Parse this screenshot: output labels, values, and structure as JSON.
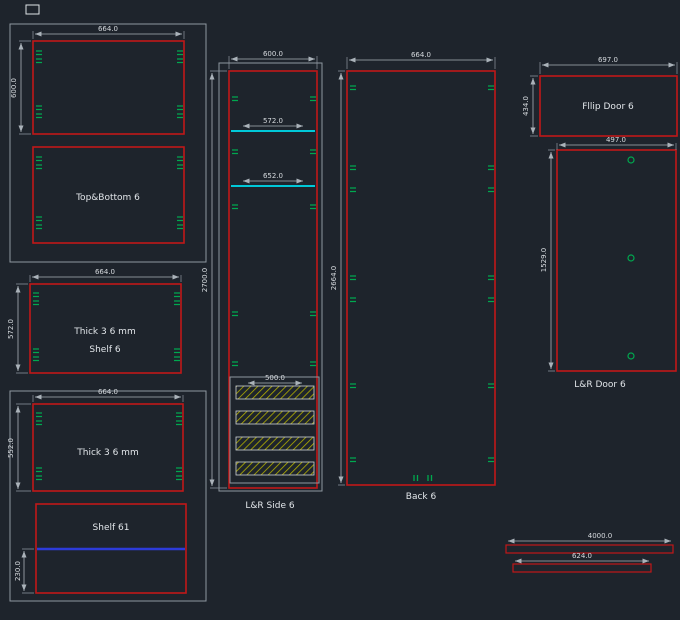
{
  "colors": {
    "background": "#1e242c",
    "panel_outline_red": "#c01818",
    "group_border_gray": "#8f97a0",
    "dimension_gray": "#aab2b9",
    "text_white": "#e2e6ea",
    "drill_mark_green": "#00a84f",
    "shelf_line_cyan": "#00c8d8",
    "hatch_yellow": "#b4b000",
    "divider_blue": "#2d3bd8"
  },
  "panels": {
    "top_bottom": {
      "label": "Top&Bottom 6",
      "width_dim": "664.0",
      "height_dim": "600.0"
    },
    "shelf_36": {
      "label_line1": "Thick 3 6 mm",
      "label_line2": "Shelf 6",
      "width_dim": "664.0",
      "height_dim": "572.0"
    },
    "thick_36": {
      "label": "Thick 3 6 mm",
      "width_dim": "664.0",
      "height_dim": "552.0"
    },
    "shelf_61": {
      "label": "Shelf 61",
      "height_dim": "230.0"
    },
    "lr_side": {
      "label": "L&R Side 6",
      "width_dim": "600.0",
      "height_dim": "2700.0",
      "inner_dim_1": "572.0",
      "inner_dim_2": "652.0",
      "hatch_dim": "500.0"
    },
    "back": {
      "label": "Back 6",
      "width_dim": "664.0",
      "height_dim": "2664.0"
    },
    "flip_door": {
      "label": "Fllip Door 6",
      "width_dim": "697.0",
      "height_dim": "434.0"
    },
    "lr_door": {
      "label": "L&R Door 6",
      "width_dim": "497.0",
      "height_dim": "1529.0"
    }
  },
  "strips": [
    {
      "dim": "4000.0"
    },
    {
      "dim": "624.0"
    }
  ]
}
